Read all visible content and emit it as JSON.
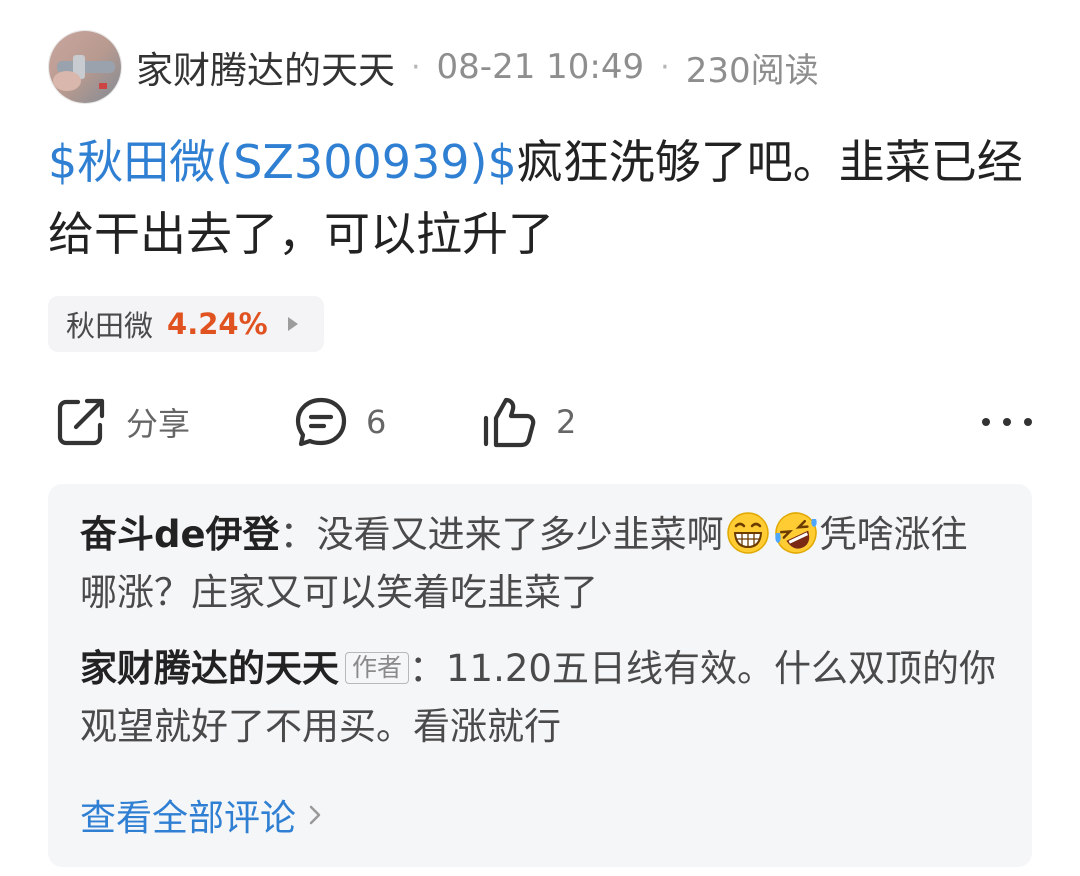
{
  "post": {
    "author": "家财腾达的天天",
    "time": "08-21 10:49",
    "reads": "230阅读",
    "separator": "·",
    "stock_tag": "$秋田微(SZ300939)$",
    "text": "疯狂洗够了吧。韭菜已经给干出去了，可以拉升了"
  },
  "stock_chip": {
    "name": "秋田微",
    "change": "4.24%"
  },
  "actions": {
    "share_label": "分享",
    "comment_count": "6",
    "like_count": "2"
  },
  "comments": [
    {
      "author": "奋斗de伊登",
      "colon": "：",
      "text_before_emoji": "没看又进来了多少韭菜啊",
      "emojis": [
        "grinning-face-icon",
        "rolling-laughing-face-icon"
      ],
      "text_after_emoji": "凭啥涨往哪涨？庄家又可以笑着吃韭菜了"
    },
    {
      "author": "家财腾达的天天",
      "author_tag": "作者",
      "colon": "：",
      "text": "11.20五日线有效。什么双顶的你观望就好了不用买。看涨就行"
    }
  ],
  "view_all_label": "查看全部评论",
  "colors": {
    "link_blue": "#2f7fd3",
    "rise_orange": "#e0521f",
    "comment_bg": "#f5f6f8"
  }
}
